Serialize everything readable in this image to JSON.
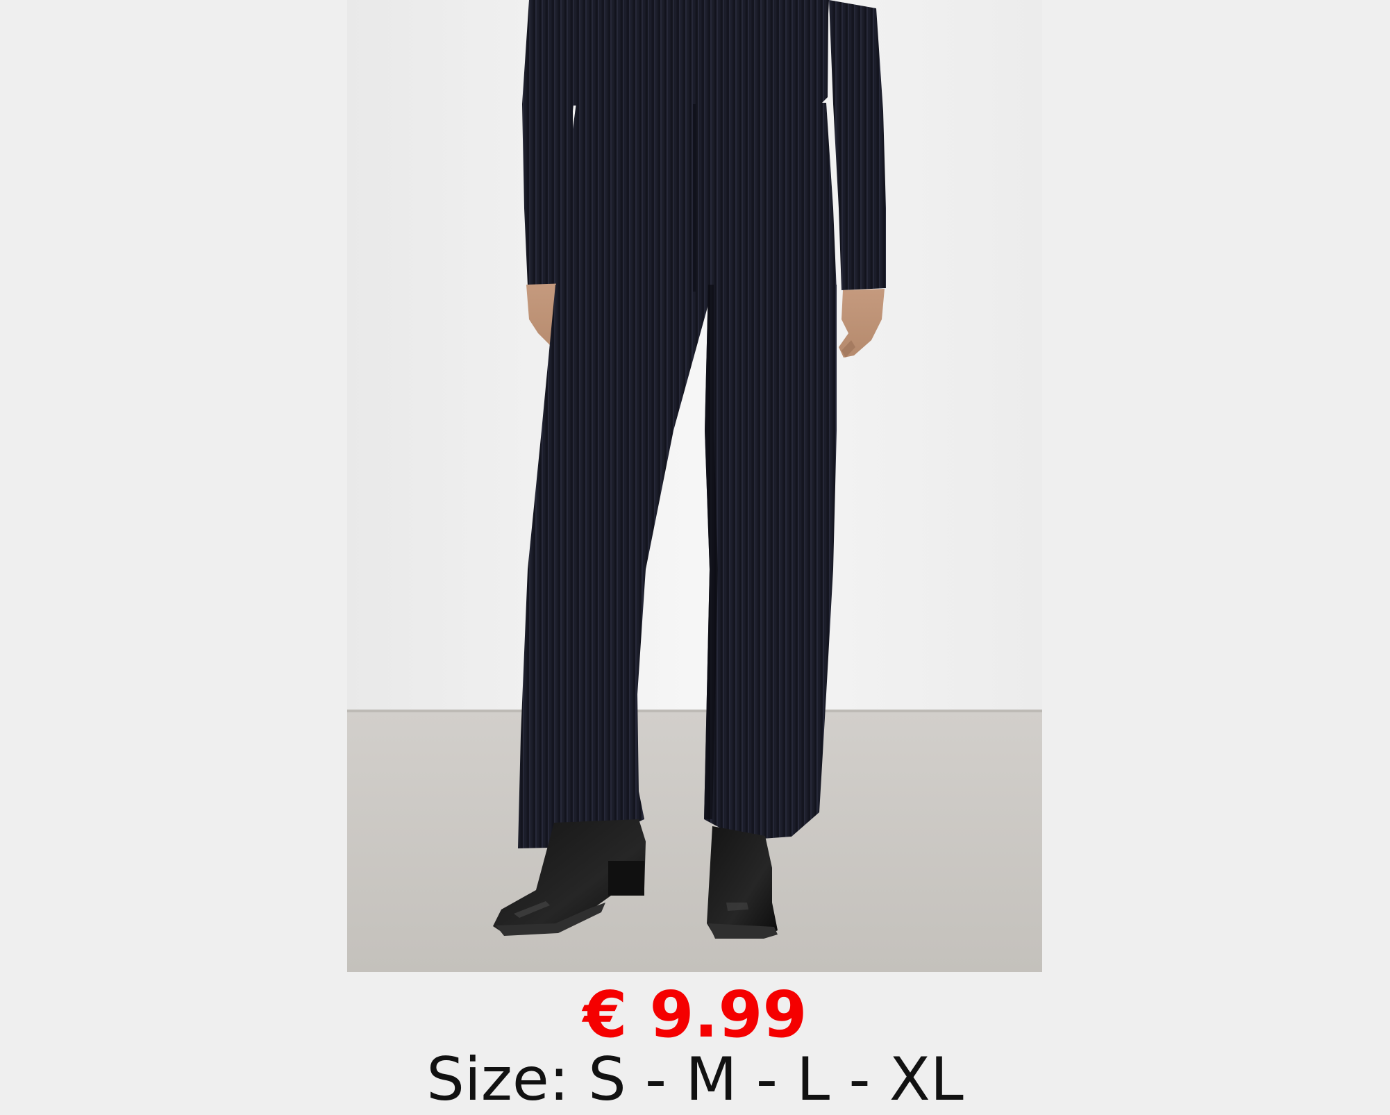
{
  "product": {
    "price": "€ 9.99",
    "sizes": "Size: S - M - L - XL",
    "price_color": "#f50000",
    "text_color": "#111111",
    "background_color": "#efefef"
  }
}
